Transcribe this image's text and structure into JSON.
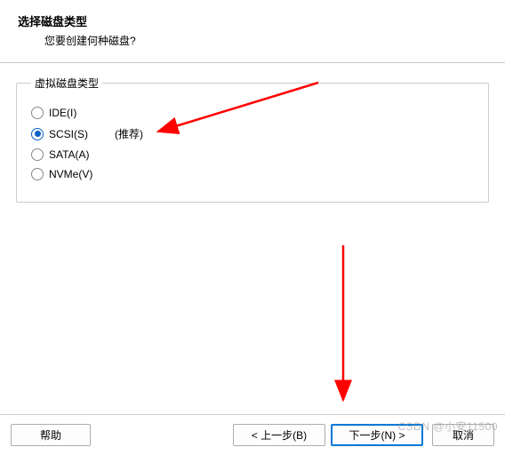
{
  "header": {
    "title": "选择磁盘类型",
    "subtitle": "您要创建何种磁盘?"
  },
  "group": {
    "legend": "虚拟磁盘类型",
    "options": [
      {
        "label": "IDE(I)",
        "checked": false,
        "recommend": ""
      },
      {
        "label": "SCSI(S)",
        "checked": true,
        "recommend": "(推荐)"
      },
      {
        "label": "SATA(A)",
        "checked": false,
        "recommend": ""
      },
      {
        "label": "NVMe(V)",
        "checked": false,
        "recommend": ""
      }
    ]
  },
  "footer": {
    "help": "帮助",
    "back": "< 上一步(B)",
    "next": "下一步(N) >",
    "cancel": "取消"
  },
  "watermark": "CSDN @小安11500"
}
